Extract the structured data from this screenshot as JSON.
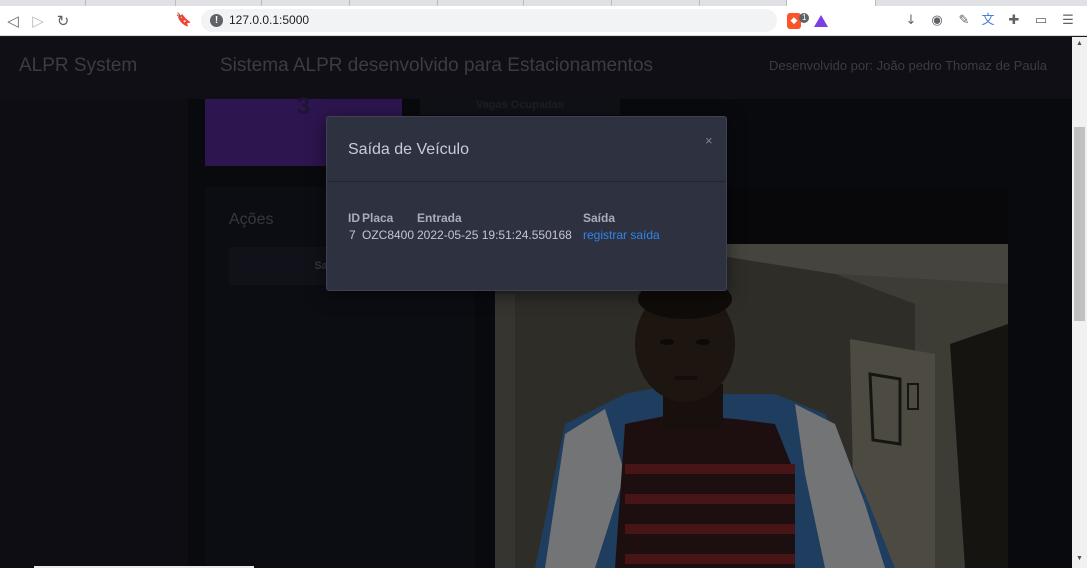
{
  "browser": {
    "url": "127.0.0.1:5000",
    "brave_shield_count": "1"
  },
  "nav": {
    "brand": "ALPR System",
    "title": "Sistema ALPR desenvolvido para Estacionamentos",
    "credit": "Desenvolvido por: João pedro Thomaz de Paula"
  },
  "stats": {
    "occupied_count": "3",
    "occupied_label": "Vagas Ocupadas"
  },
  "actions": {
    "title": "Ações",
    "exit_button": "Saída"
  },
  "modal": {
    "title": "Saída de Veículo",
    "close": "×",
    "headers": [
      "ID",
      "Placa",
      "Entrada",
      "Saída"
    ],
    "rows": [
      {
        "id": "7",
        "placa": "OZC8400",
        "entrada": "2022-05-25 19:51:24.550168",
        "saida": "registrar saída"
      }
    ]
  },
  "colors": {
    "accent": "#5a2a9e",
    "link": "#2f86eb",
    "background": "#1a1b26"
  }
}
